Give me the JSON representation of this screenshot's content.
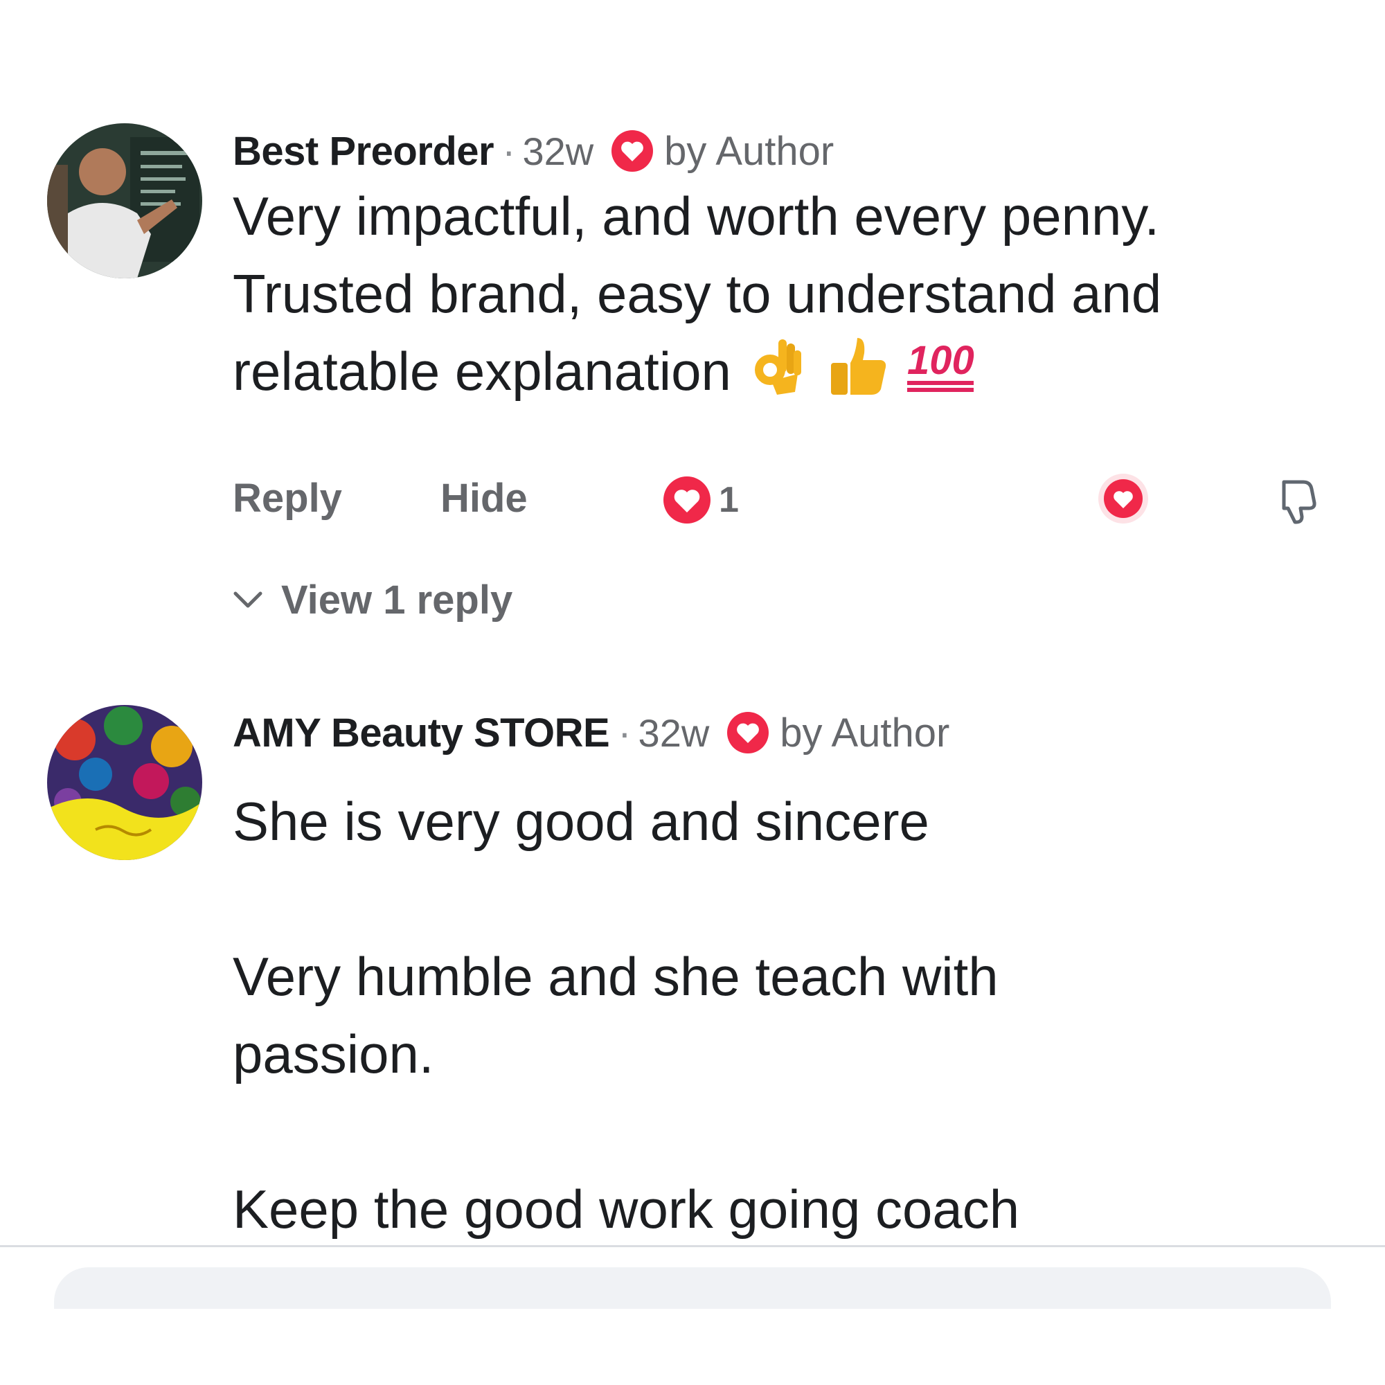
{
  "comments": [
    {
      "author": "Best Preorder",
      "separator": "·",
      "time": "32w",
      "heart_icon": "heart-icon",
      "badge": "by Author",
      "text_lines": [
        "Very impactful, and worth every penny.",
        "Trusted brand, easy to understand and",
        "relatable explanation"
      ],
      "emojis": [
        "ok-hand-emoji",
        "thumbs-up-emoji",
        "hundred-points-emoji"
      ],
      "actions": {
        "reply": "Reply",
        "hide": "Hide",
        "reaction_count": "1"
      },
      "view_replies": "View 1 reply"
    },
    {
      "author": "AMY Beauty STORE",
      "separator": "·",
      "time": "32w",
      "heart_icon": "heart-icon",
      "badge": "by Author",
      "paragraphs": [
        "She is very good and sincere",
        "Very humble and she teach with",
        "passion.",
        "Keep the good work going coach"
      ]
    }
  ],
  "colors": {
    "heart_red": "#f02849",
    "muted_text": "#65676b",
    "primary_text": "#1c1e21",
    "emoji_yellow": "#f5b41e"
  }
}
